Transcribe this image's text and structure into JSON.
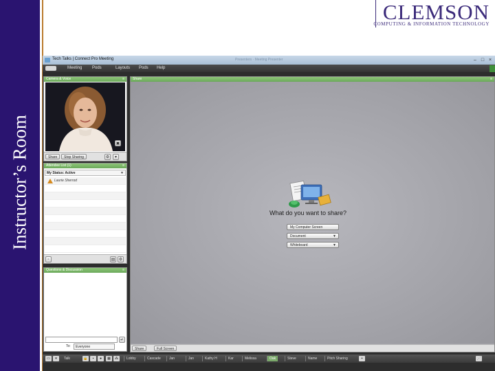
{
  "slide": {
    "side_title": "Instructor’s Room",
    "logo": {
      "word": "CLEMSON",
      "subtitle": "COMPUTING & INFORMATION TECHNOLOGY"
    }
  },
  "window": {
    "title": "Tech Talks | Connect Pro Meeting",
    "ghost_text": "Presenters · Meeting Presenter",
    "controls": {
      "minimize": "–",
      "maximize": "□",
      "close": "×"
    }
  },
  "menubar": {
    "items": [
      "Meeting",
      "Pods",
      "Layouts",
      "Pods",
      "Help"
    ]
  },
  "camera_pod": {
    "title": "Camera & Voice",
    "share_label": "Share",
    "stop_label": "Stop Sharing"
  },
  "attendee_pod": {
    "title": "Attendee List (1)",
    "status_label": "My Status: Active",
    "attendees": [
      "Laurie Sherrod",
      "",
      "",
      "",
      "",
      "",
      "",
      "",
      "",
      ""
    ]
  },
  "qa_pod": {
    "title": "Questions & Discussion",
    "to_label": "To:",
    "recipient": "Everyone"
  },
  "share_pod": {
    "title": "Share",
    "prompt": "What do you want to share?",
    "options": [
      {
        "label": "My Computer Screen",
        "dropdown": false
      },
      {
        "label": "Document",
        "dropdown": true
      },
      {
        "label": "Whiteboard",
        "dropdown": true
      }
    ],
    "footer": {
      "share_label": "Share",
      "fullscreen_label": "Full Screen"
    }
  },
  "statusbar": {
    "talk_label": "Talk",
    "items": [
      "Lobby",
      "Cascade",
      "Jan",
      "Jan",
      "Kathy H",
      "Kar",
      "Melissa",
      "Oak",
      "Steve",
      "Name",
      "Pitch Sharing"
    ],
    "active_index": 7
  },
  "colors": {
    "side_band": "#2a1470",
    "pod_header": "#7ab96a",
    "window_chrome": "#2d2d2d",
    "share_bg": "#a3a3a9"
  }
}
